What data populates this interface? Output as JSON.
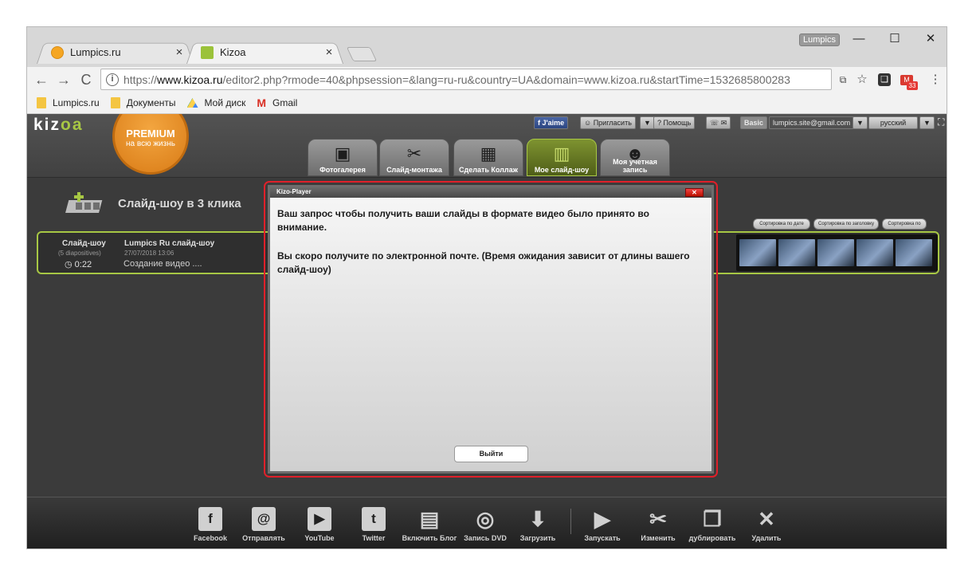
{
  "browser": {
    "tabs": [
      {
        "title": "Lumpics.ru",
        "close": "×",
        "active": false
      },
      {
        "title": "Kizoa",
        "close": "×",
        "active": true
      }
    ],
    "profile": "Lumpics",
    "window": {
      "minimize": "—",
      "maximize": "☐",
      "close": "✕"
    },
    "url": {
      "scheme": "https://",
      "domain": "www.kizoa.ru",
      "rest": "/editor2.php?rmode=40&phpsession=&lang=ru-ru&country=UA&domain=www.kizoa.ru&startTime=1532685800283"
    },
    "nav": {
      "back": "←",
      "forward": "→",
      "reload": "C"
    },
    "badge_count": "33",
    "bookmarks": [
      {
        "label": "Lumpics.ru",
        "icon": "folder-icon"
      },
      {
        "label": "Документы",
        "icon": "folder-icon"
      },
      {
        "label": "Мой диск",
        "icon": "google-drive-icon"
      },
      {
        "label": "Gmail",
        "icon": "gmail-icon"
      }
    ]
  },
  "site": {
    "logo": {
      "a": "kiz",
      "b": "oa"
    },
    "premium": {
      "line1": "PREMIUM",
      "line2": "на всю жизнь"
    },
    "top_buttons": [
      "J'aime",
      "Пригласить",
      "▼",
      "Помощь",
      "Basic",
      "lumpics.site@gmail.com",
      "▼",
      "русский",
      "▼"
    ],
    "nav_tabs": [
      "Фотогалерея",
      "Слайд-монтажа",
      "Сделать Коллаж",
      "Мое слайд-шоу",
      "Моя учетная запись"
    ],
    "page_title": "Слайд-шоу в 3 клика",
    "sort_buttons": [
      "Сортировка по дате",
      "Сортировка по заголовку",
      "Сортировка по"
    ],
    "slideshow": {
      "label": "Слайд-шоу",
      "diapos": "(5 diapositives)",
      "duration": "0:22",
      "name": "Lumpics Ru слайд-шоу",
      "date": "27/07/2018 13:06",
      "creating": "Создание видео ...."
    },
    "bottom_actions": [
      "Facebook",
      "Отправлять",
      "YouTube",
      "Twitter",
      "Включить Блог",
      "Запись DVD",
      "Загрузить",
      "Запускать",
      "Изменить",
      "дублировать",
      "Удалить"
    ]
  },
  "dialog": {
    "title": "Kizo-Player",
    "close": "✕",
    "message1": "Ваш запрос чтобы получить ваши слайды в формате видео было принято во внимание.",
    "message2": "Вы скоро получите по электронной почте. (Время ожидания зависит от длины вашего слайд-шоу)",
    "exit": "Выйти"
  },
  "colors": {
    "accent": "#a7c744",
    "highlight": "#e0202a",
    "premium": "#e58a1d"
  }
}
